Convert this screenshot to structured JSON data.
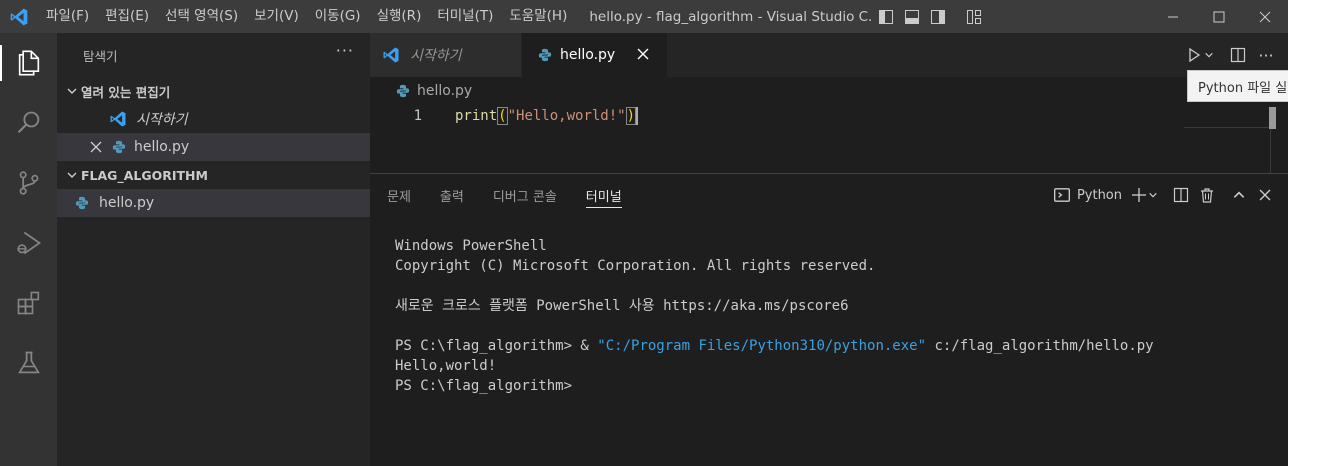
{
  "titlebar": {
    "menus": [
      "파일(F)",
      "편집(E)",
      "선택 영역(S)",
      "보기(V)",
      "이동(G)",
      "실행(R)",
      "터미널(T)",
      "도움말(H)"
    ],
    "title": "hello.py - flag_algorithm - Visual Studio C..."
  },
  "sidebar": {
    "title": "탐색기",
    "more": "···",
    "open_editors_label": "열려 있는 편집기",
    "open_editors": [
      {
        "label": "시작하기"
      },
      {
        "label": "hello.py"
      }
    ],
    "folder_label": "FLAG_ALGORITHM",
    "files": [
      {
        "label": "hello.py"
      }
    ]
  },
  "editor": {
    "tabs": [
      {
        "label": "시작하기"
      },
      {
        "label": "hello.py"
      }
    ],
    "breadcrumb": "hello.py",
    "line_number": "1",
    "code": {
      "func": "print",
      "open": "(",
      "string": "\"Hello,world!\"",
      "close": ")"
    }
  },
  "tooltip": "Python 파일 실행",
  "panel": {
    "tabs": [
      "문제",
      "출력",
      "디버그 콘솔",
      "터미널"
    ],
    "terminal_name": "Python",
    "terminal": {
      "line1": "Windows PowerShell",
      "line2": "Copyright (C) Microsoft Corporation. All rights reserved.",
      "line3": "새로운 크로스 플랫폼 PowerShell 사용 https://aka.ms/pscore6",
      "line4_prefix": "PS C:\\flag_algorithm> & ",
      "line4_string": "\"C:/Program Files/Python310/python.exe\"",
      "line4_suffix": " c:/flag_algorithm/hello.py",
      "line5": "Hello,world!",
      "line6": "PS C:\\flag_algorithm>"
    }
  },
  "colors": {
    "vscode_blue": "#0078d4",
    "python_blue": "#519aba",
    "titlebar": "#3c3c3c",
    "activitybar": "#333333",
    "sidebar": "#252526",
    "editor": "#1e1e1e"
  }
}
